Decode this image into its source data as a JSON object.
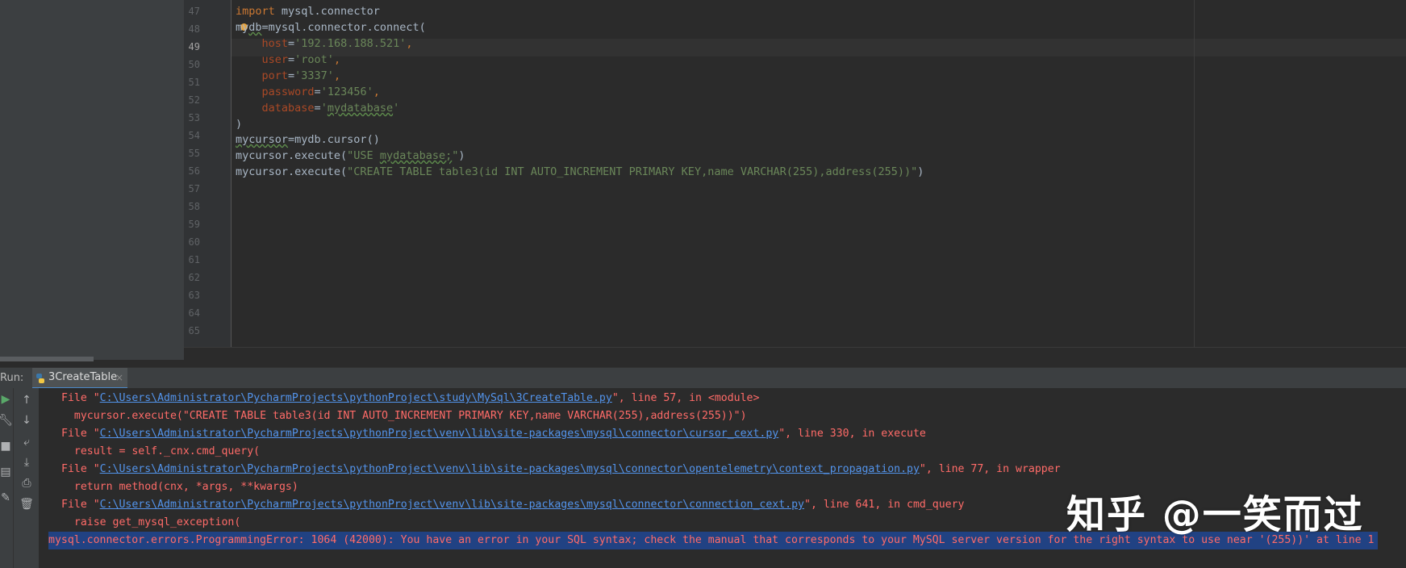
{
  "editor": {
    "active_line": "49",
    "line_numbers": [
      "47",
      "48",
      "49",
      "50",
      "51",
      "52",
      "53",
      "54",
      "55",
      "56",
      "57",
      "58",
      "59",
      "60",
      "61",
      "62",
      "63",
      "64",
      "65"
    ],
    "code": {
      "l47_kw": "import",
      "l47_rest": " mysql.connector",
      "l48_a": "my",
      "l48_b": "db",
      "l48_c": "=mysql.connector.connect(",
      "l49_p": "host",
      "l49_s": "'192.168.188.521'",
      "l50_p": "user",
      "l50_s": "'root'",
      "l51_p": "port",
      "l51_s": "'3337'",
      "l52_p": "password",
      "l52_s": "'123456'",
      "l53_p": "database",
      "l53_q1": "'",
      "l53_sq": "mydatabase",
      "l53_q2": "'",
      "l54": ")",
      "l55_a": "mycursor",
      "l55_b": "=mydb.cursor()",
      "l56_a": "mycursor.execute(",
      "l56_s1": "\"USE ",
      "l56_sq": "mydatabase;",
      "l56_s2": "\"",
      "l56_b": ")",
      "l57_a": "mycursor.execute(",
      "l57_s": "\"CREATE TABLE table3(id INT AUTO_INCREMENT PRIMARY KEY,name VARCHAR(255),address(255))\"",
      "l57_b": ")"
    }
  },
  "run_panel": {
    "label": "Run:",
    "tab_label": "3CreateTable",
    "tab_close": "×",
    "toolbar_icons": [
      "run-icon",
      "wrench-icon",
      "stop-icon",
      "layout-icon",
      "pin-icon",
      "up-arrow-icon",
      "down-arrow-icon",
      "soft-wrap-icon",
      "scroll-to-end-icon",
      "print-icon",
      "trash-icon"
    ]
  },
  "console": {
    "l1_pre": "File \"",
    "l1_link": "C:\\Users\\Administrator\\PycharmProjects\\pythonProject\\study\\MySql\\3CreateTable.py",
    "l1_post": "\", line 57, in <module>",
    "l2": "  mycursor.execute(\"CREATE TABLE table3(id INT AUTO_INCREMENT PRIMARY KEY,name VARCHAR(255),address(255))\")",
    "l3_pre": "File \"",
    "l3_link": "C:\\Users\\Administrator\\PycharmProjects\\pythonProject\\venv\\lib\\site-packages\\mysql\\connector\\cursor_cext.py",
    "l3_post": "\", line 330, in execute",
    "l4": "  result = self._cnx.cmd_query(",
    "l5_pre": "File \"",
    "l5_link": "C:\\Users\\Administrator\\PycharmProjects\\pythonProject\\venv\\lib\\site-packages\\mysql\\connector\\opentelemetry\\context_propagation.py",
    "l5_post": "\", line 77, in wrapper",
    "l6": "  return method(cnx, *args, **kwargs)",
    "l7_pre": "File \"",
    "l7_link": "C:\\Users\\Administrator\\PycharmProjects\\pythonProject\\venv\\lib\\site-packages\\mysql\\connector\\connection_cext.py",
    "l7_post": "\", line 641, in cmd_query",
    "l8": "  raise get_mysql_exception(",
    "l9": "mysql.connector.errors.ProgrammingError: 1064 (42000): You have an error in your SQL syntax; check the manual that corresponds to your MySQL server version for the right syntax to use near '(255))' at line 1"
  },
  "watermark": "知乎 @一笑而过",
  "colors": {
    "background": "#2b2b2b",
    "keyword": "#cc7832",
    "string": "#6a8759",
    "error": "#ff6b68",
    "link": "#5394ec",
    "selection": "#214283"
  }
}
